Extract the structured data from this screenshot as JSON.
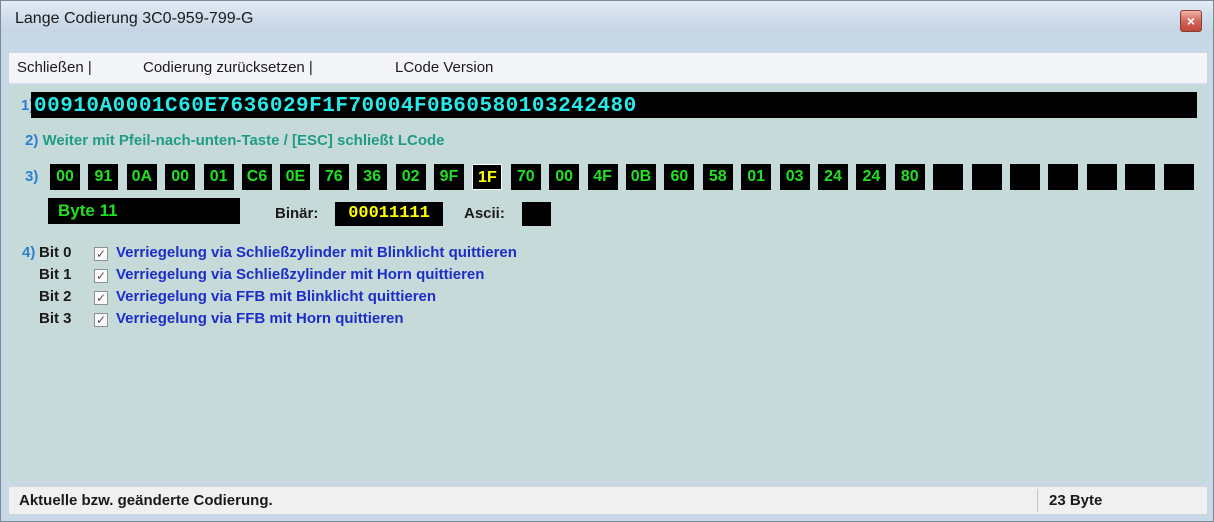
{
  "window": {
    "title": "Lange Codierung  3C0-959-799-G",
    "close_glyph": "×"
  },
  "menu": [
    "Schließen |",
    "Codierung zurücksetzen |",
    "LCode Version"
  ],
  "section1": {
    "num": "1)",
    "code": "00910A0001C60E7636029F1F70004F0B60580103242480"
  },
  "section2": {
    "num": "2)",
    "text": "Weiter mit Pfeil-nach-unten-Taste / [ESC] schließt LCode"
  },
  "section3": {
    "num": "3)",
    "bytes": [
      "00",
      "91",
      "0A",
      "00",
      "01",
      "C6",
      "0E",
      "76",
      "36",
      "02",
      "9F",
      "1F",
      "70",
      "00",
      "4F",
      "0B",
      "60",
      "58",
      "01",
      "03",
      "24",
      "24",
      "80",
      "",
      "",
      "",
      "",
      "",
      "",
      ""
    ],
    "selected_index": 11
  },
  "byte_info": {
    "byte_label": "Byte 11",
    "binary_label": "Binär:",
    "binary_value": "00011111",
    "ascii_label": "Ascii:",
    "ascii_value": ""
  },
  "section4": {
    "num": "4)",
    "bits": [
      {
        "name": "Bit 0",
        "checked": true,
        "text": "Verriegelung via Schließzylinder mit Blinklicht quittieren"
      },
      {
        "name": "Bit 1",
        "checked": true,
        "text": "Verriegelung via Schließzylinder mit Horn quittieren"
      },
      {
        "name": "Bit 2",
        "checked": true,
        "text": "Verriegelung via FFB mit Blinklicht quittieren"
      },
      {
        "name": "Bit 3",
        "checked": true,
        "text": "Verriegelung via FFB mit Horn quittieren"
      }
    ]
  },
  "status": {
    "left": "Aktuelle bzw. geänderte Codierung.",
    "right": "23 Byte"
  },
  "colors": {
    "code_text": "#29e8e8",
    "byte_text": "#21e021",
    "selected_byte": "#ffff00",
    "bit_text": "#1d2ec7",
    "hint_text": "#1f9b86",
    "client_bg": "#c7dada"
  }
}
